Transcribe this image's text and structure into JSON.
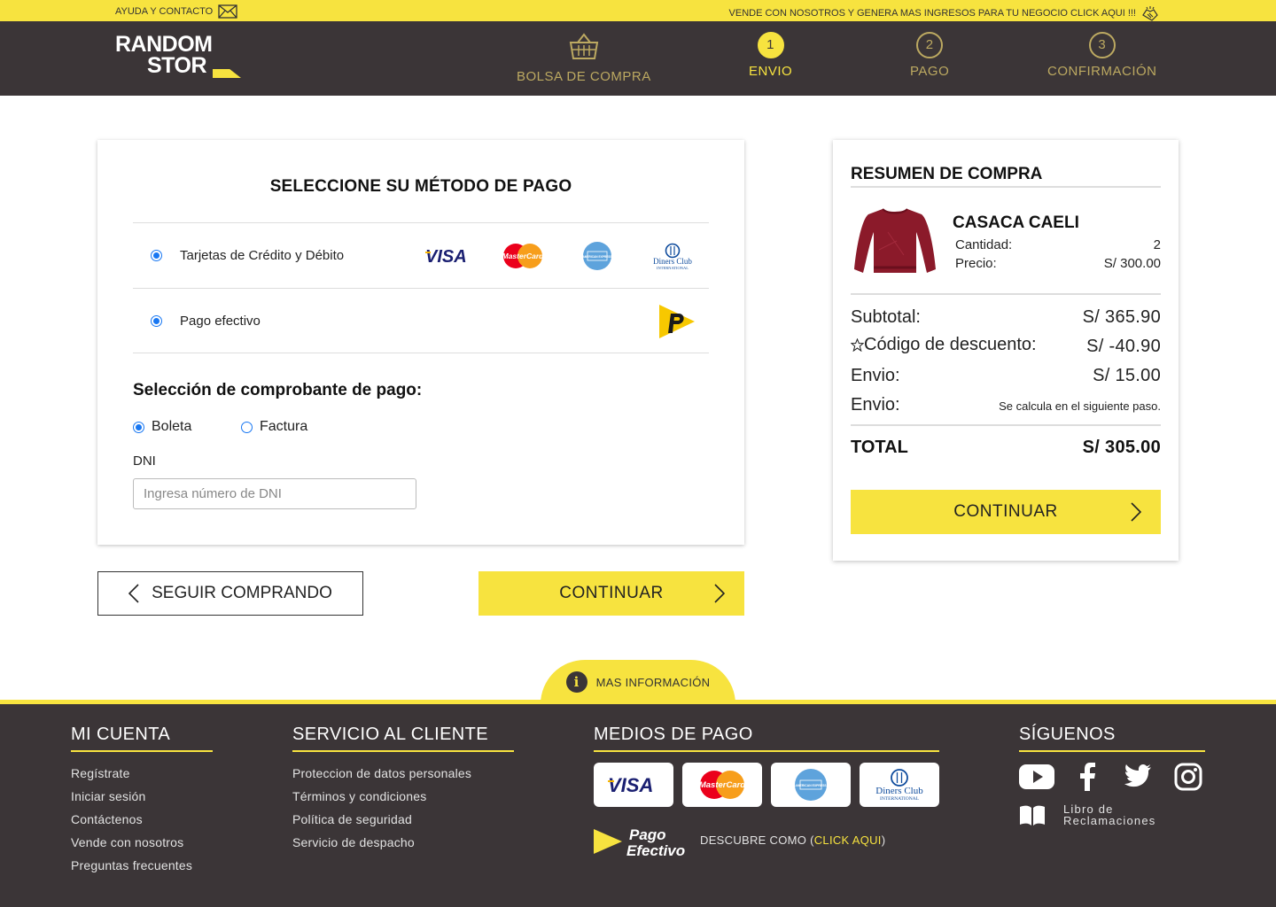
{
  "topbar": {
    "help": "AYUDA Y CONTACTO",
    "sell": "VENDE CON NOSOTROS Y  GENERA MAS INGRESOS PARA TU NEGOCIO CLICK AQUI !!!"
  },
  "header": {
    "logo_line1": "RANDOM",
    "logo_line2": "STOR",
    "steps": [
      {
        "label": "BOLSA DE COMPRA",
        "number": ""
      },
      {
        "label": "ENVIO",
        "number": "1"
      },
      {
        "label": "PAGO",
        "number": "2"
      },
      {
        "label": "CONFIRMACIÓN",
        "number": "3"
      }
    ],
    "active_step": "ENVIO"
  },
  "payment": {
    "title": "SELECCIONE SU MÉTODO DE PAGO",
    "methods": [
      {
        "label": "Tarjetas de Crédito y Débito",
        "selected": true
      },
      {
        "label": "Pago efectivo",
        "selected": true
      }
    ],
    "card_logos": [
      "VISA",
      "MasterCard",
      "AMERICAN EXPRESS",
      "Diners Club",
      "INTERNATIONAL"
    ],
    "voucher_title": "Selección de comprobante de pago:",
    "voucher_options": [
      {
        "label": "Boleta",
        "selected": true
      },
      {
        "label": "Factura",
        "selected": false
      }
    ],
    "dni_label": "DNI",
    "dni_placeholder": "Ingresa número de DNI",
    "dni_value": ""
  },
  "buttons": {
    "back": "SEGUIR COMPRANDO",
    "continue": "CONTINUAR"
  },
  "summary": {
    "title": "RESUMEN DE COMPRA",
    "product": {
      "name": "CASACA CAELI",
      "qty_label": "Cantidad:",
      "qty": "2",
      "price_label": "Precio:",
      "price": "S/ 300.00"
    },
    "lines": [
      {
        "label": "Subtotal:",
        "value": "S/  365.90"
      },
      {
        "label": "Código de descuento:",
        "value": "S/ -40.90"
      },
      {
        "label": "Envio:",
        "value": "S/  15.00"
      },
      {
        "label": "Envio:",
        "value": "Se calcula en el siguiente paso."
      }
    ],
    "total_label": "TOTAL",
    "total_value": "S/  305.00",
    "continue": "CONTINUAR"
  },
  "info_tab": "MAS INFORMACIÓN",
  "footer": {
    "mi_cuenta": {
      "title": "MI CUENTA",
      "links": [
        "Regístrate",
        "Iniciar sesión",
        "Contáctenos",
        "Vende con nosotros",
        "Preguntas frecuentes"
      ]
    },
    "servicio": {
      "title": "SERVICIO AL CLIENTE",
      "links": [
        "Proteccion de datos personales",
        "Términos y condiciones",
        "Política de seguridad",
        "Servicio de despacho"
      ]
    },
    "medios": {
      "title": "MEDIOS DE PAGO",
      "pago_efectivo_1": "Pago",
      "pago_efectivo_2": "Efectivo",
      "descubre": "DESCUBRE COMO (",
      "click": "CLICK AQUI",
      "close": ")"
    },
    "siguenos": {
      "title": "SÍGUENOS",
      "libro_1": "Libro de",
      "libro_2": "Reclamaciones"
    }
  },
  "colors": {
    "accent": "#f7e33f",
    "dark": "#3b3537",
    "step_inactive": "#bca961",
    "radio": "#1877f2"
  }
}
